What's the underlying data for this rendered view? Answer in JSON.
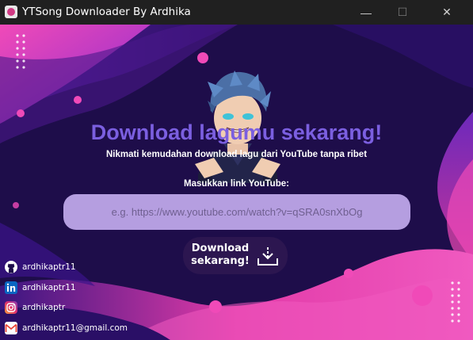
{
  "window": {
    "title": "YTSong Downloader By Ardhika",
    "minimize_glyph": "—",
    "maximize_glyph": "☐",
    "close_glyph": "✕"
  },
  "main": {
    "heading": "Download lagumu sekarang!",
    "subtitle": "Nikmati kemudahan download lagu dari YouTube tanpa ribet",
    "input_label": "Masukkan link YouTube:",
    "url_input": {
      "value": "",
      "placeholder": "e.g. https://www.youtube.com/watch?v=qSRA0snXbOg"
    },
    "download_button": {
      "line1": "Download",
      "line2": "sekarang!",
      "icon": "download-icon"
    }
  },
  "socials": [
    {
      "icon": "github-icon",
      "text": "ardhikaptr11"
    },
    {
      "icon": "linkedin-icon",
      "text": "ardhikaptr11"
    },
    {
      "icon": "instagram-icon",
      "text": "ardhikaptr"
    },
    {
      "icon": "gmail-icon",
      "text": "ardhikaptr11@gmail.com"
    }
  ],
  "colors": {
    "titlebar": "#202020",
    "background": "#1e0d4a",
    "heading": "#7b5fe0",
    "input_bg": "#b59ee0",
    "button_bg": "#2c1650",
    "accent_pink": "#e63aa8"
  }
}
